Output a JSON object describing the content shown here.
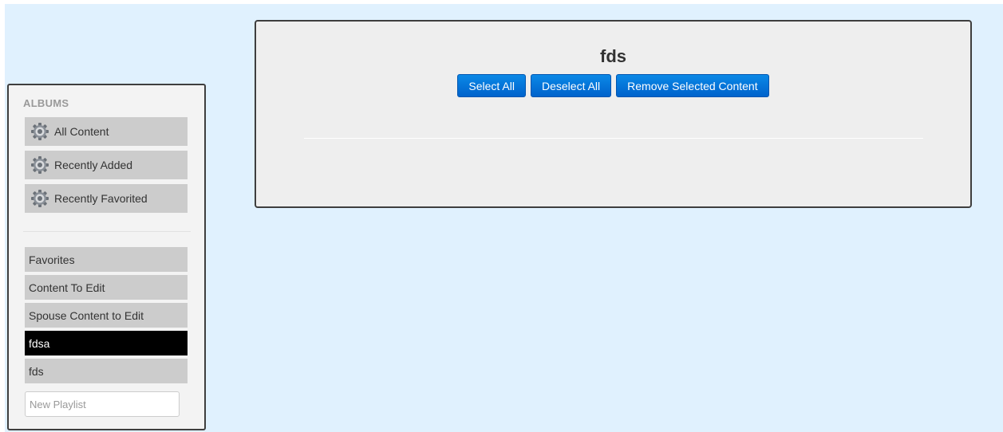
{
  "sidebar": {
    "heading": "ALBUMS",
    "albums": [
      {
        "label": "All Content",
        "icon": "gear-icon"
      },
      {
        "label": "Recently Added",
        "icon": "gear-icon"
      },
      {
        "label": "Recently Favorited",
        "icon": "gear-icon"
      }
    ],
    "playlists": [
      {
        "label": "Favorites",
        "active": false
      },
      {
        "label": "Content To Edit",
        "active": false
      },
      {
        "label": "Spouse Content to Edit",
        "active": false
      },
      {
        "label": "fdsa",
        "active": true
      },
      {
        "label": "fds",
        "active": false
      }
    ],
    "new_playlist_placeholder": "New Playlist"
  },
  "main": {
    "title": "fds",
    "buttons": {
      "select_all": "Select All",
      "deselect_all": "Deselect All",
      "remove_selected": "Remove Selected Content"
    }
  },
  "colors": {
    "page_background": "#e0f1fe",
    "button_blue": "#0063cc",
    "active_playlist": "#000000"
  }
}
